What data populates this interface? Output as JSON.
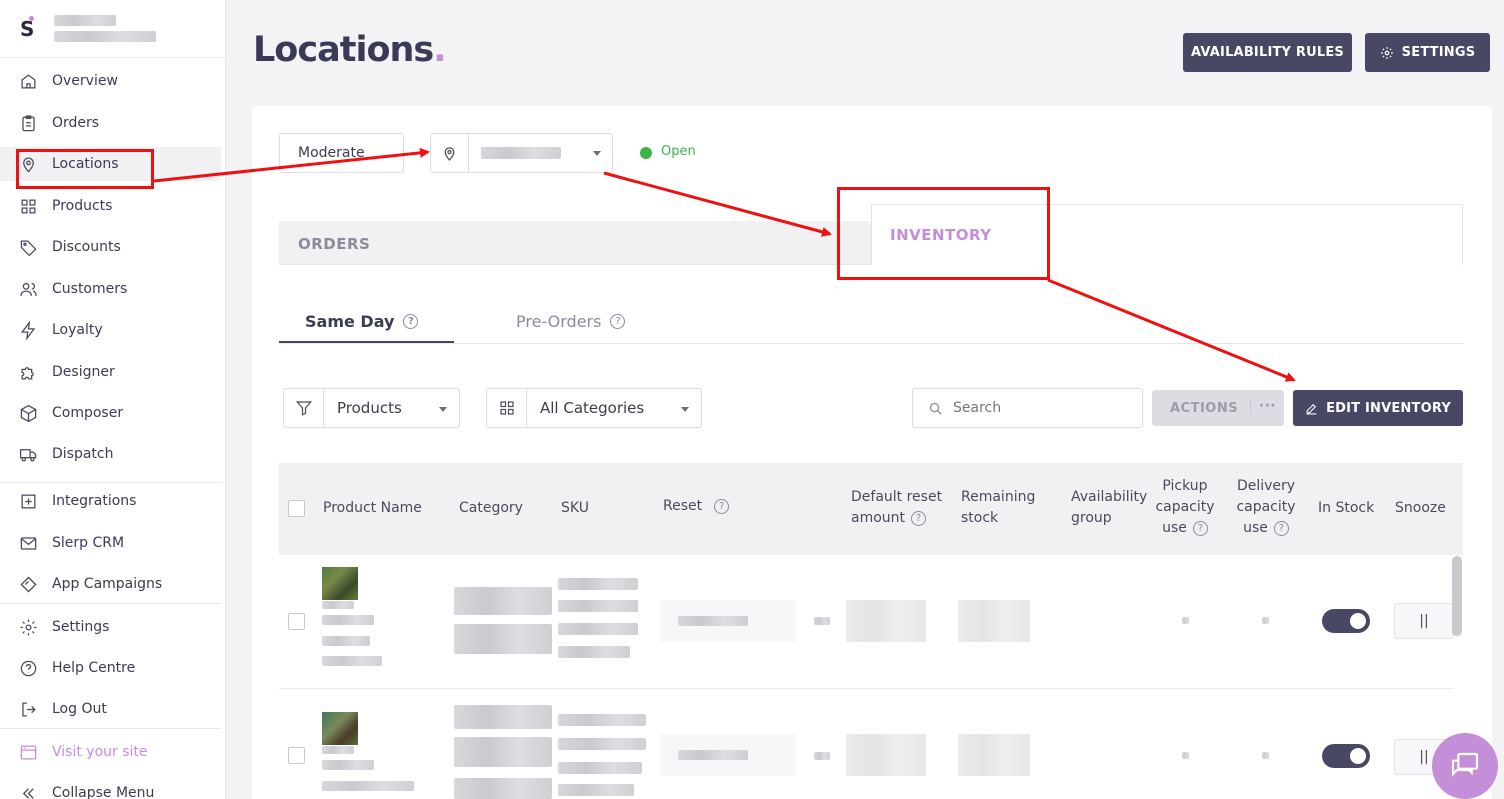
{
  "sidebar": {
    "nav": [
      {
        "label": "Overview",
        "icon": "home-icon"
      },
      {
        "label": "Orders",
        "icon": "clipboard-icon"
      },
      {
        "label": "Locations",
        "icon": "map-pin-icon"
      },
      {
        "label": "Products",
        "icon": "grid-icon"
      },
      {
        "label": "Discounts",
        "icon": "tag-icon"
      },
      {
        "label": "Customers",
        "icon": "users-icon"
      },
      {
        "label": "Loyalty",
        "icon": "lightning-icon"
      },
      {
        "label": "Designer",
        "icon": "puzzle-icon"
      },
      {
        "label": "Composer",
        "icon": "box-icon"
      },
      {
        "label": "Dispatch",
        "icon": "truck-icon"
      },
      {
        "label": "Integrations",
        "icon": "plus-square-icon"
      },
      {
        "label": "Slerp CRM",
        "icon": "mail-icon"
      },
      {
        "label": "App Campaigns",
        "icon": "diamond-icon"
      },
      {
        "label": "Settings",
        "icon": "gear-icon"
      },
      {
        "label": "Help Centre",
        "icon": "question-circle-icon"
      },
      {
        "label": "Log Out",
        "icon": "logout-icon"
      },
      {
        "label": "Visit your site",
        "icon": "browser-icon"
      },
      {
        "label": "Collapse Menu",
        "icon": "chevrons-left-icon"
      }
    ]
  },
  "header": {
    "title": "Locations",
    "title_dot": ".",
    "availability_rules": "AVAILABILITY RULES",
    "settings": "SETTINGS"
  },
  "filters": {
    "mode": "Moderate",
    "status": "Open"
  },
  "tabs": {
    "orders": "ORDERS",
    "inventory": "INVENTORY"
  },
  "subtabs": {
    "same_day": "Same Day",
    "pre_orders": "Pre-Orders"
  },
  "toolbar": {
    "type_filter": "Products",
    "category_filter": "All Categories",
    "search_placeholder": "Search",
    "actions": "ACTIONS",
    "actions_more": "···",
    "edit_inventory": "EDIT INVENTORY"
  },
  "table": {
    "columns": {
      "product_name": "Product Name",
      "category": "Category",
      "sku": "SKU",
      "reset": "Reset",
      "default_reset_1": "Default reset",
      "default_reset_2": "amount",
      "remaining_1": "Remaining",
      "remaining_2": "stock",
      "availability_1": "Availability",
      "availability_2": "group",
      "pickup_1": "Pickup",
      "pickup_2": "capacity",
      "pickup_3": "use",
      "delivery_1": "Delivery",
      "delivery_2": "capacity",
      "delivery_3": "use",
      "in_stock": "In Stock",
      "snooze": "Snooze"
    },
    "row_snooze_symbol": "||",
    "help_symbol": "?"
  },
  "colors": {
    "accent": "#c58ed8",
    "dark_button": "#484865",
    "open_green": "#3bb54a",
    "annotation_red": "#ee1111"
  }
}
